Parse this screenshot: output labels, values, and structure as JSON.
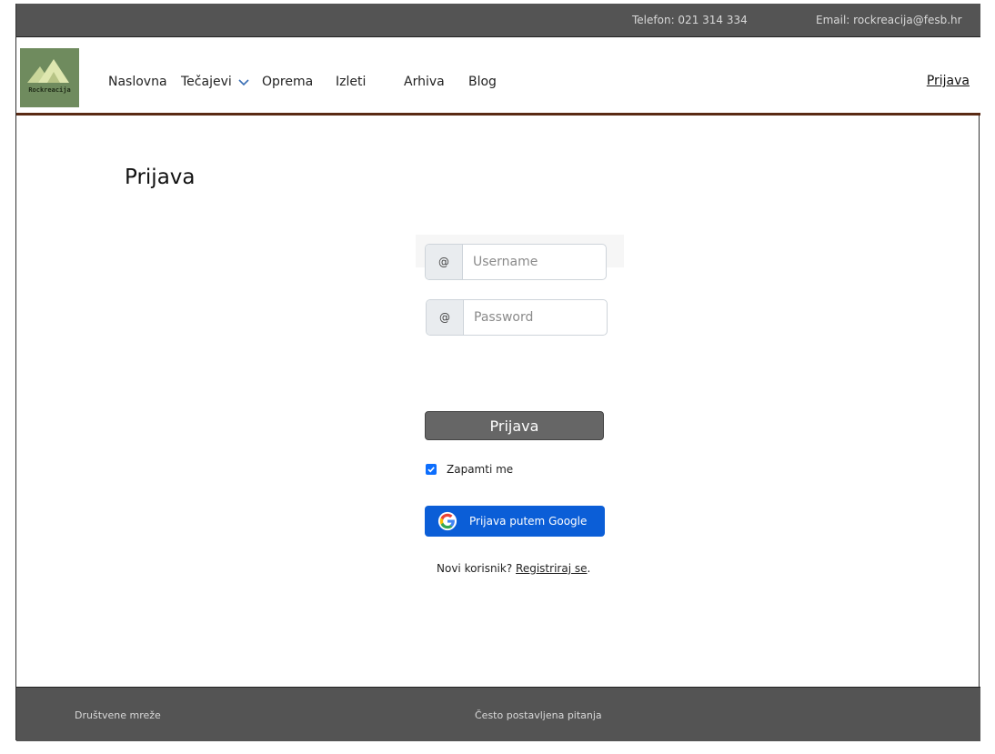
{
  "topbar": {
    "phone": "Telefon: 021 314 334",
    "email": "Email: rockreacija@fesb.hr"
  },
  "brand": {
    "logo_text": "Rockreacija",
    "logo_color": "#6f8b5e"
  },
  "nav": {
    "items": [
      {
        "label": "Naslovna"
      },
      {
        "label": "Tečajevi",
        "has_dropdown": true
      },
      {
        "label": "Oprema"
      },
      {
        "label": "Izleti"
      },
      {
        "label": "Arhiva"
      },
      {
        "label": "Blog"
      }
    ],
    "login_link": "Prijava"
  },
  "main": {
    "title": "Prijava",
    "username": {
      "addon": "@",
      "placeholder": "Username",
      "value": ""
    },
    "password": {
      "addon": "@",
      "placeholder": "Password",
      "value": ""
    },
    "submit_label": "Prijava",
    "remember": {
      "label": "Zapamti me",
      "checked": true
    },
    "google_button": "Prijava putem Google",
    "signup": {
      "prefix": "Novi korisnik?",
      "link": "Registriraj se",
      "suffix": "."
    }
  },
  "footer": {
    "social": "Društvene mreže",
    "faq": "Često postavljena pitanja"
  },
  "colors": {
    "bar": "#545454",
    "nav_border": "#5a2a14",
    "primary": "#0b5ed7",
    "submit": "#666666"
  }
}
